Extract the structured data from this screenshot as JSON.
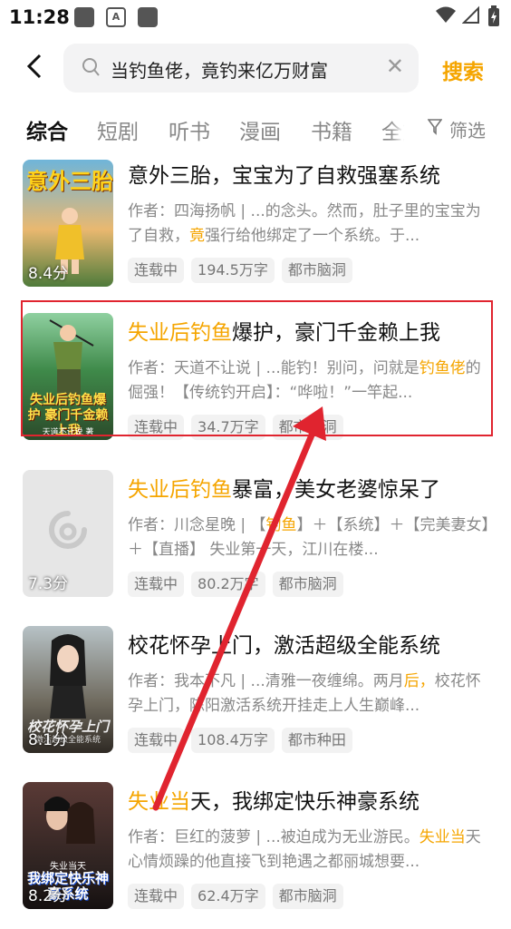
{
  "status_bar": {
    "time": "11:28"
  },
  "header": {
    "back_icon": "back-arrow-icon",
    "search_query": "当钓鱼佬，竟钓来亿万财富",
    "search_button": "搜索"
  },
  "tabs": [
    "综合",
    "短剧",
    "听书",
    "漫画",
    "书籍",
    "全文"
  ],
  "filter_label": "筛选",
  "results": [
    {
      "title_pre": "",
      "title_hl": "",
      "title_post": "意外三胎，宝宝为了自救强塞系统",
      "cover_title": "意外三胎",
      "score": "8.4分",
      "author": "作者：四海扬帆",
      "desc_a": "...的念头。然而，肚子里的宝宝为了自救，",
      "desc_hl": "竟",
      "desc_b": "强行给他绑定了一个系统。于...",
      "tags": [
        "连载中",
        "194.5万字",
        "都市脑洞"
      ]
    },
    {
      "title_pre": "",
      "title_hl": "失业后钓鱼",
      "title_post": "爆护，豪门千金赖上我",
      "cover_title": "失业后钓鱼爆护 豪门千金赖上我",
      "cover_author": "天道不让说 著",
      "score": "",
      "author": "作者：天道不让说",
      "desc_a": "...能钓！别问，问就是",
      "desc_hl": "钓鱼佬",
      "desc_b": "的倔强！【传统钓开启】：“哗啦！”一竿起...",
      "tags": [
        "连载中",
        "34.7万字",
        "都市脑洞"
      ]
    },
    {
      "title_pre": "",
      "title_hl": "失业后钓鱼",
      "title_post": "暴富，美女老婆惊呆了",
      "cover_title": "",
      "score": "7.3分",
      "author": "作者：川念星晚",
      "desc_a": "【",
      "desc_hl": "钓鱼",
      "desc_b": "】＋【系统】＋【完美妻女】＋【直播】 失业第一天，江川在楼...",
      "tags": [
        "连载中",
        "80.2万字",
        "都市脑洞"
      ]
    },
    {
      "title_pre": "",
      "title_hl": "",
      "title_post": "校花怀孕上门，激活超级全能系统",
      "cover_title": "校花怀孕上门",
      "cover_author": "激活超级全能系统",
      "score": "8.1分",
      "author": "作者：我本不凡",
      "desc_a": "...清雅一夜缠绵。两月",
      "desc_hl": "后，",
      "desc_b": "校花怀孕上门，陈阳激活系统开挂走上人生巅峰...",
      "tags": [
        "连载中",
        "108.4万字",
        "都市种田"
      ]
    },
    {
      "title_pre": "",
      "title_hl": "失业当",
      "title_post": "天，我绑定快乐神豪系统",
      "cover_title": "我绑定快乐神豪系统",
      "cover_author": "失业当天",
      "score": "8.2分",
      "author": "作者：巨红的菠萝",
      "desc_a": "...被迫成为无业游民。",
      "desc_hl": "失业当",
      "desc_b": "天心情烦躁的他直接飞到艳遇之都丽城想要...",
      "tags": [
        "连载中",
        "62.4万字",
        "都市脑洞"
      ]
    }
  ],
  "colors": {
    "accent": "#f5a500",
    "annotation": "#e0242f"
  }
}
